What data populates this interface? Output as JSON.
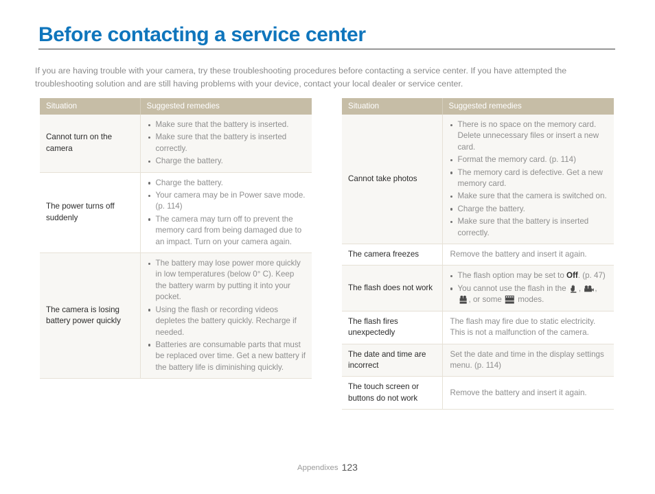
{
  "page": {
    "title": "Before contacting a service center",
    "intro": "If you are having trouble with your camera, try these troubleshooting procedures before contacting a service center. If you have attempted the troubleshooting solution and are still having problems with your device, contact your local dealer or service center.",
    "accent_color": "#0f75bc",
    "header_row_color": "#c6bda6",
    "shade_row_color": "#f8f7f4",
    "body_text_color": "#8e8e8e"
  },
  "footer": {
    "section_label": "Appendixes",
    "page_number": "123"
  },
  "tables": {
    "left": {
      "headers": {
        "situation": "Situation",
        "remedies": "Suggested remedies"
      },
      "rows": [
        {
          "situation": "Cannot turn on the camera",
          "remedies": [
            "Make sure that the battery is inserted.",
            "Make sure that the battery is inserted correctly.",
            "Charge the battery."
          ]
        },
        {
          "situation": "The power turns off suddenly",
          "remedies": [
            "Charge the battery.",
            "Your camera may be in Power save mode. (p. 114)",
            "The camera may turn off to prevent the memory card from being damaged due to an impact. Turn on your camera again."
          ]
        },
        {
          "situation": "The camera is losing battery power quickly",
          "remedies": [
            "The battery may lose power more quickly in low temperatures (below 0° C). Keep the battery warm by putting it into your pocket.",
            "Using the flash or recording videos depletes the battery quickly. Recharge if needed.",
            "Batteries are consumable parts that must be replaced over time. Get a new battery if the battery life is diminishing quickly."
          ]
        }
      ]
    },
    "right": {
      "headers": {
        "situation": "Situation",
        "remedies": "Suggested remedies"
      },
      "rows": [
        {
          "situation": "Cannot take photos",
          "remedies": [
            "There is no space on the memory card. Delete unnecessary files or insert a new card.",
            "Format the memory card. (p. 114)",
            "The memory card is defective. Get a new memory card.",
            "Make sure that the camera is switched on.",
            "Charge the battery.",
            "Make sure that the battery is inserted correctly."
          ]
        },
        {
          "situation": "The camera freezes",
          "remedy_text": "Remove the battery and insert it again."
        },
        {
          "situation": "The flash does not work",
          "remedies_rich": [
            {
              "before": "The flash option may be set to ",
              "bold": "Off",
              "after": ". (p. 47)"
            },
            {
              "before": "You cannot use the flash in the ",
              "icons": [
                "hand-shake-mode-icon",
                "movie-mode-icon",
                "smart-movie-mode-icon"
              ],
              "middle": ", or some ",
              "last_icon": "scene-mode-icon",
              "after": " modes."
            }
          ]
        },
        {
          "situation": "The flash fires unexpectedly",
          "remedy_text": "The flash may fire due to static electricity. This is not a malfunction of the camera."
        },
        {
          "situation": "The date and time are incorrect",
          "remedy_text": "Set the date and time in the display settings menu. (p. 114)"
        },
        {
          "situation": "The touch screen or buttons do not work",
          "remedy_text": "Remove the battery and insert it again."
        }
      ]
    }
  }
}
